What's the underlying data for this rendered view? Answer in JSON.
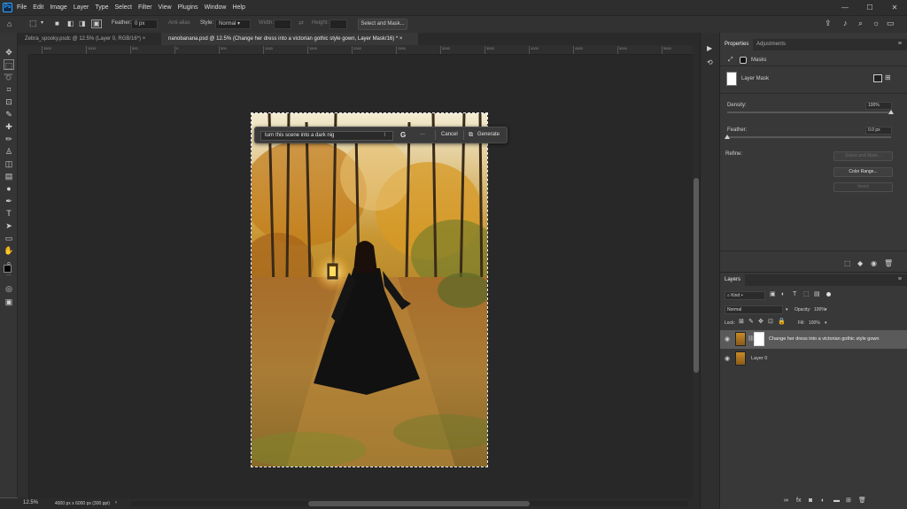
{
  "app": {
    "logo": "Ps",
    "menu": [
      "File",
      "Edit",
      "Image",
      "Layer",
      "Type",
      "Select",
      "Filter",
      "View",
      "Plugins",
      "Window",
      "Help"
    ]
  },
  "options": {
    "feather_label": "Feather:",
    "feather_value": "0 px",
    "antialias_label": "Anti-alias",
    "style_label": "Style:",
    "style_value": "Normal",
    "width_label": "Width:",
    "height_label": "Height:",
    "select_mask_button": "Select and Mask..."
  },
  "tabs": [
    {
      "label": "Zebra_spooky.psdc @ 12.5% (Layer 0, RGB/16*)",
      "close": "×"
    },
    {
      "label": "nanobanana.psd @ 12.5% (Change her dress into a victorian gothic style gown, Layer Mask/16) *",
      "close": "×"
    }
  ],
  "ruler_ticks": [
    "1500",
    "1000",
    "500",
    "0",
    "500",
    "1000",
    "1500",
    "2000",
    "2500",
    "3000",
    "3500",
    "4000",
    "4500",
    "5000",
    "5500"
  ],
  "context_bar": {
    "prompt_value": "turn this scene into a dark nig",
    "more": "···",
    "cancel": "Cancel",
    "generate": "Generate"
  },
  "status": {
    "zoom": "12.5%",
    "doc_info": "4000 px x 6000 px (300 ppi)"
  },
  "properties": {
    "tab_properties": "Properties",
    "tab_adjustments": "Adjustments",
    "masks_label": "Masks",
    "layer_mask_label": "Layer Mask",
    "density_label": "Density:",
    "density_value": "100%",
    "density_fraction": 1.0,
    "feather_label": "Feather:",
    "feather_value": "0.0 px",
    "feather_fraction": 0.0,
    "refine_label": "Refine:",
    "select_mask_button": "Select and Mask...",
    "color_range_button": "Color Range...",
    "invert_button": "Invert"
  },
  "layers_panel": {
    "title": "Layers",
    "filter_kind": "Kind",
    "blend_mode": "Normal",
    "opacity_label": "Opacity:",
    "opacity_value": "100%",
    "lock_label": "Lock:",
    "fill_label": "Fill:",
    "fill_value": "100%",
    "layers": [
      {
        "name": "Change her dress into a victorian gothic style gown",
        "selected": true
      },
      {
        "name": "Layer 0",
        "selected": false
      }
    ]
  },
  "colors": {
    "accent": "#31a8ff",
    "pasteboard": "#282828",
    "panel": "#383838"
  }
}
